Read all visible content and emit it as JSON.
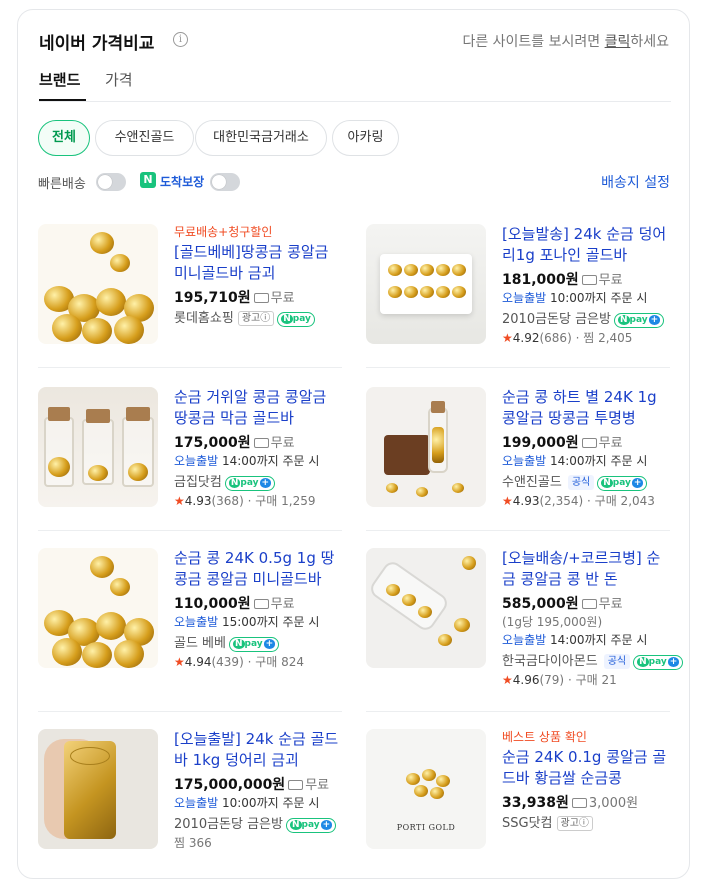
{
  "header": {
    "title": "네이버 가격비교",
    "info_icon": "info-icon",
    "other_sites": "다른 사이트를 보시려면 ",
    "other_sites_link": "클릭",
    "other_sites_tail": "하세요"
  },
  "tabs": [
    {
      "label": "브랜드",
      "active": true
    },
    {
      "label": "가격",
      "active": false
    }
  ],
  "chips": [
    {
      "label": "전체",
      "active": true
    },
    {
      "label": "수앤진골드",
      "active": false
    },
    {
      "label": "대한민국금거래소",
      "active": false
    },
    {
      "label": "아카링",
      "active": false
    }
  ],
  "filters": {
    "fast_delivery": "빠른배송",
    "arrival_guarantee": "도착보장",
    "delivery_setting": "배송지 설정"
  },
  "products": [
    {
      "promo": "무료배송+청구할인",
      "title": "[골드베베]땅콩금 콩알금 미니골드바 금괴",
      "price": "195,710원",
      "shipping": "무료",
      "seller": "롯데홈쇼핑",
      "ad": "광고",
      "npay": true
    },
    {
      "title": "[오늘발송] 24k 순금 덩어리1g 포나인 골드바",
      "price": "181,000원",
      "shipping": "무료",
      "today_label": "오늘출발",
      "today_text": " 10:00까지 주문 시",
      "seller": "2010금돈당 금은방",
      "npay_plus": true,
      "rating": "4.92",
      "rating_count": "(686)",
      "extra": "· 찜 2,405"
    },
    {
      "title": "순금 거위알 콩금 콩알금 땅콩금 막금 골드바",
      "price": "175,000원",
      "shipping": "무료",
      "today_label": "오늘출발",
      "today_text": " 14:00까지 주문 시",
      "seller": "금집닷컴",
      "npay_plus": true,
      "rating": "4.93",
      "rating_count": "(368)",
      "extra": "· 구매 1,259"
    },
    {
      "title": "순금 콩 하트 별 24K 1g 콩알금 땅콩금 투명병",
      "price": "199,000원",
      "shipping": "무료",
      "today_label": "오늘출발",
      "today_text": " 14:00까지 주문 시",
      "seller": "수앤진골드",
      "official": "공식",
      "npay_plus": true,
      "rating": "4.93",
      "rating_count": "(2,354)",
      "extra": "· 구매 2,043"
    },
    {
      "title": "순금 콩 24K 0.5g 1g 땅콩금 콩알금 미니골드바",
      "price": "110,000원",
      "shipping": "무료",
      "today_label": "오늘출발",
      "today_text": " 15:00까지 주문 시",
      "seller": "골드 베베",
      "npay_plus": true,
      "rating": "4.94",
      "rating_count": "(439)",
      "extra": "· 구매 824"
    },
    {
      "title": "[오늘배송/+코르크병] 순금 콩알금 콩 반 돈",
      "price": "585,000원",
      "shipping": "무료",
      "unit_price": "(1g당 195,000원)",
      "today_label": "오늘출발",
      "today_text": " 14:00까지 주문 시",
      "seller": "한국금다이아몬드",
      "official": "공식",
      "npay_plus": true,
      "rating": "4.96",
      "rating_count": "(79)",
      "extra": "· 구매 21"
    },
    {
      "title": "[오늘출발] 24k 순금 골드바 1kg 덩어리 금괴",
      "price": "175,000,000원",
      "shipping": "무료",
      "today_label": "오늘출발",
      "today_text": " 10:00까지 주문 시",
      "seller": "2010금돈당 금은방",
      "npay_plus": true,
      "extra2": "찜 366"
    },
    {
      "promo": "베스트 상품 확인",
      "title": "순금 24K 0.1g 콩알금 골드바 황금쌀 순금콩",
      "price": "33,938원",
      "shipping": "3,000원",
      "seller": "SSG닷컴",
      "ad": "광고",
      "thumb_text": "PORTI GOLD"
    }
  ],
  "icons": [
    "truck-icon",
    "star-icon",
    "npay-icon",
    "info-icon"
  ]
}
